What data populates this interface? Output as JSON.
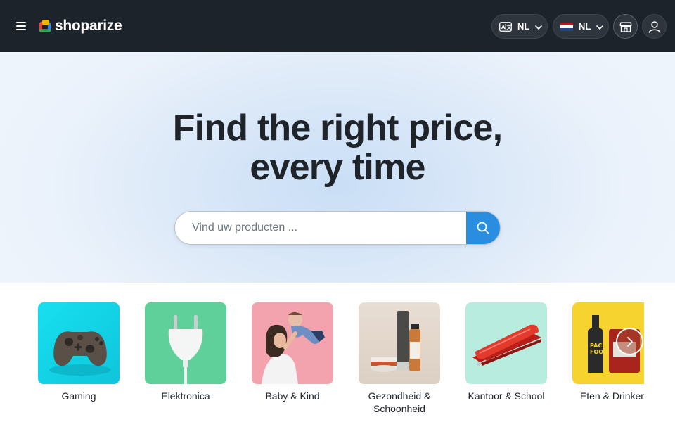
{
  "header": {
    "brand": "shoparize",
    "language_selector": {
      "label": "NL"
    },
    "country_selector": {
      "label": "NL"
    }
  },
  "hero": {
    "title_line1": "Find the right price,",
    "title_line2": "every time",
    "search": {
      "placeholder": "Vind uw producten ..."
    }
  },
  "categories": [
    {
      "label": "Gaming",
      "icon": "game-controller"
    },
    {
      "label": "Elektronica",
      "icon": "power-plug"
    },
    {
      "label": "Baby & Kind",
      "icon": "mother-baby"
    },
    {
      "label": "Gezondheid & Schoonheid",
      "icon": "cosmetics"
    },
    {
      "label": "Kantoor & School",
      "icon": "stapler"
    },
    {
      "label": "Eten & Drinken",
      "icon": "food-packaging"
    }
  ],
  "colors": {
    "header_bg": "#1c232b",
    "search_button": "#2a8ee0",
    "text_dark": "#1e2429"
  }
}
